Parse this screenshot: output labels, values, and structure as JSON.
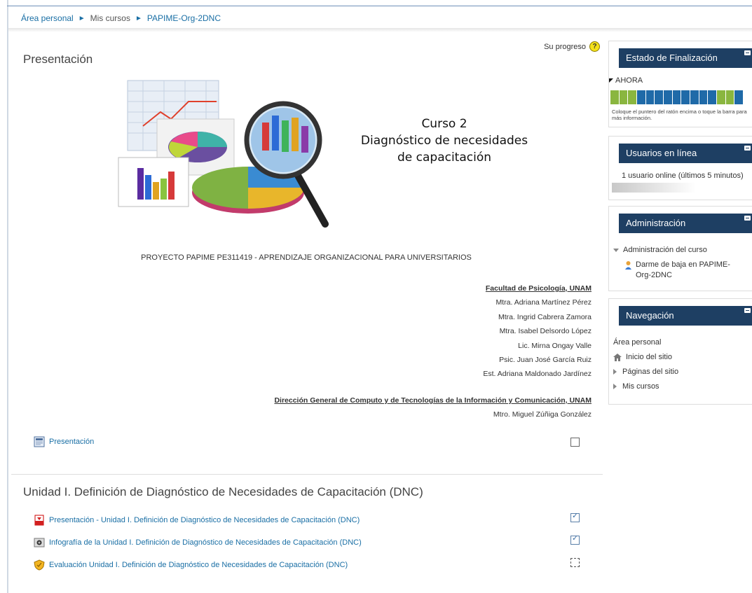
{
  "breadcrumb": {
    "home": "Área personal",
    "courses": "Mis cursos",
    "course": "PAPIME-Org-2DNC"
  },
  "main": {
    "section_title": "Presentación",
    "progress_label": "Su progreso",
    "help_glyph": "?",
    "banner": {
      "line1": "Curso 2",
      "line2": "Diagnóstico de necesidades",
      "line3": "de capacitación"
    },
    "project": "PROYECTO PAPIME PE311419  - APRENDIZAJE ORGANIZACIONAL PARA UNIVERSITARIOS",
    "credits_unam": {
      "head": "Facultad de Psicología, UNAM",
      "people": [
        "Mtra. Adriana Martínez Pérez",
        "Mtra. Ingrid Cabrera Zamora",
        "Mtra. Isabel Delsordo López",
        "Lic. Mirna Ongay Valle",
        "Psic. Juan José García Ruiz",
        "Est. Adriana Maldonado Jardínez"
      ]
    },
    "credits_dgtic": {
      "head": "Dirección General de Computo y de Tecnologías de la Información y Comunicación, UNAM",
      "people": [
        "Mtro. Miguel Zúñiga González"
      ]
    },
    "presentation_link": "Presentación",
    "unit_title": "Unidad I. Definición de Diagnóstico de Necesidades de Capacitación (DNC)",
    "unit_activities": [
      {
        "label": "Presentación - Unidad I. Definición de Diagnóstico de Necesidades de Capacitación (DNC)",
        "icon": "pdf-icon",
        "status": "done"
      },
      {
        "label": "Infografía de la Unidad I. Definición de Diagnóstico de Necesidades de Capacitación (DNC)",
        "icon": "image-icon",
        "status": "done"
      },
      {
        "label": "Evaluación Unidad I. Definición de Diagnóstico de Necesidades de Capacitación (DNC)",
        "icon": "quiz-icon",
        "status": "pending"
      }
    ],
    "check_mark": "✓"
  },
  "sidebar": {
    "completion": {
      "title": "Estado de Finalización",
      "now": "AHORA",
      "segments": [
        "done",
        "done",
        "done",
        "todo",
        "todo",
        "todo",
        "todo",
        "todo",
        "todo",
        "todo",
        "todo",
        "todo",
        "done",
        "done",
        "todo"
      ],
      "note": "Coloque el puntero del ratón encima o toque la barra para más información.",
      "colors": {
        "done": "#8ab63f",
        "todo": "#1f6aa8"
      }
    },
    "online": {
      "title": "Usuarios en línea",
      "text": "1 usuario online (últimos 5 minutos)"
    },
    "admin": {
      "title": "Administración",
      "course_admin": "Administración del curso",
      "unenrol": "Darme de baja en PAPIME-Org-2DNC"
    },
    "navigation": {
      "title": "Navegación",
      "home": "Área personal",
      "site_home": "Inicio del sitio",
      "site_pages": "Páginas del sitio",
      "my_courses": "Mis cursos"
    }
  }
}
